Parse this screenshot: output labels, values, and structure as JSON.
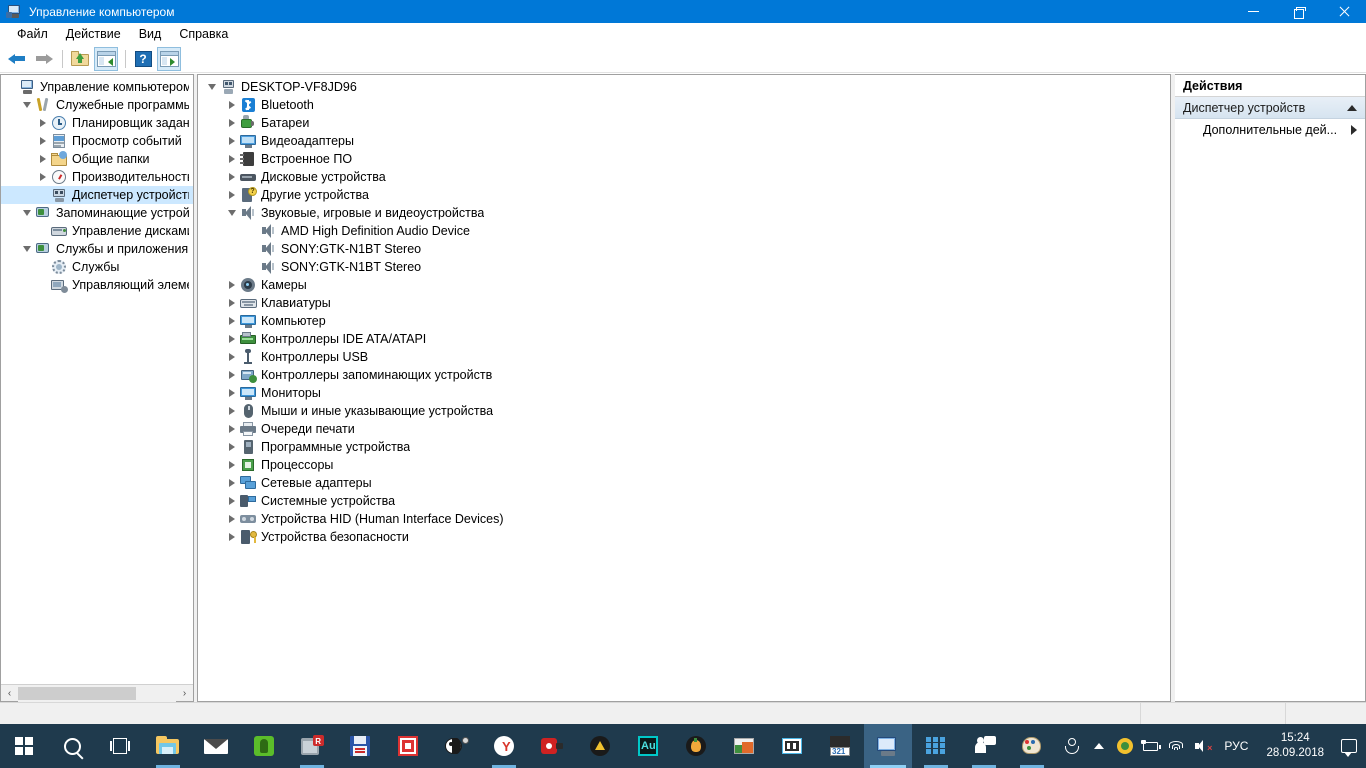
{
  "window": {
    "title": "Управление компьютером",
    "icon": "computer-management-icon",
    "controls": {
      "minimize": "minimize",
      "restore": "restore",
      "close": "close"
    }
  },
  "menubar": {
    "items": [
      {
        "label": "Файл",
        "name": "menu-file"
      },
      {
        "label": "Действие",
        "name": "menu-action"
      },
      {
        "label": "Вид",
        "name": "menu-view"
      },
      {
        "label": "Справка",
        "name": "menu-help"
      }
    ]
  },
  "toolbar": {
    "buttons": [
      {
        "name": "back-button",
        "icon": "arrow-left-icon"
      },
      {
        "name": "forward-button",
        "icon": "arrow-right-icon"
      },
      {
        "name": "up-one-level-button",
        "icon": "folder-up-icon"
      },
      {
        "name": "show-hide-tree-button",
        "icon": "window-tree-icon"
      },
      {
        "name": "help-button",
        "icon": "question-mark-icon"
      },
      {
        "name": "properties-button",
        "icon": "window-play-icon"
      }
    ]
  },
  "sidebar": {
    "items": [
      {
        "label": "Управление компьютером (л",
        "icon": "computer-icon",
        "depth": 0,
        "twist": "none",
        "selected": false
      },
      {
        "label": "Служебные программы",
        "icon": "tools-icon",
        "depth": 1,
        "twist": "open",
        "selected": false
      },
      {
        "label": "Планировщик заданий",
        "icon": "clock-icon",
        "depth": 2,
        "twist": "closed",
        "selected": false
      },
      {
        "label": "Просмотр событий",
        "icon": "event-log-icon",
        "depth": 2,
        "twist": "closed",
        "selected": false
      },
      {
        "label": "Общие папки",
        "icon": "shared-folder-icon",
        "depth": 2,
        "twist": "closed",
        "selected": false
      },
      {
        "label": "Производительность",
        "icon": "performance-icon",
        "depth": 2,
        "twist": "closed",
        "selected": false
      },
      {
        "label": "Диспетчер устройств",
        "icon": "device-manager-icon",
        "depth": 2,
        "twist": "none",
        "selected": true
      },
      {
        "label": "Запоминающие устройст",
        "icon": "storage-icon",
        "depth": 1,
        "twist": "open",
        "selected": false
      },
      {
        "label": "Управление дисками",
        "icon": "disk-management-icon",
        "depth": 2,
        "twist": "none",
        "selected": false
      },
      {
        "label": "Службы и приложения",
        "icon": "services-apps-icon",
        "depth": 1,
        "twist": "open",
        "selected": false
      },
      {
        "label": "Службы",
        "icon": "services-icon",
        "depth": 2,
        "twist": "none",
        "selected": false
      },
      {
        "label": "Управляющий элемен",
        "icon": "wmi-control-icon",
        "depth": 2,
        "twist": "none",
        "selected": false
      }
    ],
    "scrollbar": {
      "left_arrow": "‹",
      "right_arrow": "›"
    }
  },
  "device_tree": {
    "items": [
      {
        "label": "DESKTOP-VF8JD96",
        "icon": "pc-icon",
        "depth": 0,
        "twist": "open"
      },
      {
        "label": "Bluetooth",
        "icon": "bluetooth-icon",
        "depth": 1,
        "twist": "closed"
      },
      {
        "label": "Батареи",
        "icon": "battery-icon",
        "depth": 1,
        "twist": "closed"
      },
      {
        "label": "Видеоадаптеры",
        "icon": "display-adapter-icon",
        "depth": 1,
        "twist": "closed"
      },
      {
        "label": "Встроенное ПО",
        "icon": "firmware-icon",
        "depth": 1,
        "twist": "closed"
      },
      {
        "label": "Дисковые устройства",
        "icon": "disk-drive-icon",
        "depth": 1,
        "twist": "closed"
      },
      {
        "label": "Другие устройства",
        "icon": "other-device-icon",
        "depth": 1,
        "twist": "closed"
      },
      {
        "label": "Звуковые, игровые и видеоустройства",
        "icon": "speaker-icon",
        "depth": 1,
        "twist": "open"
      },
      {
        "label": "AMD High Definition Audio Device",
        "icon": "speaker-icon",
        "depth": 2,
        "twist": "none"
      },
      {
        "label": "SONY:GTK-N1BT Stereo",
        "icon": "speaker-icon",
        "depth": 2,
        "twist": "none"
      },
      {
        "label": "SONY:GTK-N1BT Stereo",
        "icon": "speaker-icon",
        "depth": 2,
        "twist": "none"
      },
      {
        "label": "Камеры",
        "icon": "camera-icon",
        "depth": 1,
        "twist": "closed"
      },
      {
        "label": "Клавиатуры",
        "icon": "keyboard-icon",
        "depth": 1,
        "twist": "closed"
      },
      {
        "label": "Компьютер",
        "icon": "monitor-icon",
        "depth": 1,
        "twist": "closed"
      },
      {
        "label": "Контроллеры IDE ATA/ATAPI",
        "icon": "ide-controller-icon",
        "depth": 1,
        "twist": "closed"
      },
      {
        "label": "Контроллеры USB",
        "icon": "usb-icon",
        "depth": 1,
        "twist": "closed"
      },
      {
        "label": "Контроллеры запоминающих устройств",
        "icon": "storage-controller-icon",
        "depth": 1,
        "twist": "closed"
      },
      {
        "label": "Мониторы",
        "icon": "monitor-icon",
        "depth": 1,
        "twist": "closed"
      },
      {
        "label": "Мыши и иные указывающие устройства",
        "icon": "mouse-icon",
        "depth": 1,
        "twist": "closed"
      },
      {
        "label": "Очереди печати",
        "icon": "printer-icon",
        "depth": 1,
        "twist": "closed"
      },
      {
        "label": "Программные устройства",
        "icon": "software-device-icon",
        "depth": 1,
        "twist": "closed"
      },
      {
        "label": "Процессоры",
        "icon": "cpu-icon",
        "depth": 1,
        "twist": "closed"
      },
      {
        "label": "Сетевые адаптеры",
        "icon": "network-adapter-icon",
        "depth": 1,
        "twist": "closed"
      },
      {
        "label": "Системные устройства",
        "icon": "system-device-icon",
        "depth": 1,
        "twist": "closed"
      },
      {
        "label": "Устройства HID (Human Interface Devices)",
        "icon": "hid-icon",
        "depth": 1,
        "twist": "closed"
      },
      {
        "label": "Устройства безопасности",
        "icon": "security-device-icon",
        "depth": 1,
        "twist": "closed"
      }
    ]
  },
  "actions_pane": {
    "header": "Действия",
    "group_label": "Диспетчер устройств",
    "items": [
      {
        "label": "Дополнительные дей...",
        "name": "more-actions-item"
      }
    ]
  },
  "taskbar": {
    "start": {
      "name": "start-button",
      "icon": "windows-logo-icon"
    },
    "search": {
      "name": "search-button",
      "icon": "search-icon"
    },
    "taskview": {
      "name": "task-view-button",
      "icon": "task-view-icon"
    },
    "apps": [
      {
        "name": "file-explorer",
        "icon": "folder-icon",
        "state": "running"
      },
      {
        "name": "mail",
        "icon": "envelope-icon",
        "state": "idle"
      },
      {
        "name": "evernote",
        "icon": "evernote-icon",
        "state": "idle"
      },
      {
        "name": "rstudio",
        "icon": "rstudio-icon",
        "state": "running"
      },
      {
        "name": "save-app",
        "icon": "floppy-disk-icon",
        "state": "idle"
      },
      {
        "name": "red-app",
        "icon": "red-square-icon",
        "state": "idle"
      },
      {
        "name": "bee-app",
        "icon": "bee-icon",
        "state": "idle"
      },
      {
        "name": "yandex-browser",
        "icon": "yandex-icon",
        "state": "running"
      },
      {
        "name": "camtasia",
        "icon": "camtasia-icon",
        "state": "idle"
      },
      {
        "name": "aimp",
        "icon": "aimp-icon",
        "state": "idle"
      },
      {
        "name": "audition",
        "icon": "audition-icon",
        "state": "idle"
      },
      {
        "name": "fl-studio",
        "icon": "fl-studio-icon",
        "state": "idle"
      },
      {
        "name": "photo-viewer",
        "icon": "photo-icon",
        "state": "idle"
      },
      {
        "name": "video-editor",
        "icon": "film-icon",
        "state": "idle"
      },
      {
        "name": "mpc-player",
        "icon": "mpc-321-icon",
        "state": "idle"
      },
      {
        "name": "computer-management",
        "icon": "computer-management-icon",
        "state": "active"
      },
      {
        "name": "tiles-app",
        "icon": "tiles-icon",
        "state": "running"
      },
      {
        "name": "people-app",
        "icon": "people-chat-icon",
        "state": "running"
      },
      {
        "name": "paint-app",
        "icon": "paint-palette-icon",
        "state": "running"
      }
    ],
    "tray": {
      "people": {
        "name": "people-tray-icon",
        "icon": "person-icon"
      },
      "expand": {
        "name": "show-hidden-icons",
        "icon": "chevron-up-icon"
      },
      "icons": [
        {
          "name": "updater-tray-icon",
          "icon": "green-circle-icon"
        },
        {
          "name": "battery-tray-icon",
          "icon": "battery-icon"
        },
        {
          "name": "network-tray-icon",
          "icon": "wifi-icon"
        },
        {
          "name": "volume-tray-icon",
          "icon": "speaker-muted-icon"
        }
      ],
      "language": "РУС",
      "time": "15:24",
      "date": "28.09.2018",
      "action_center": {
        "name": "action-center-button",
        "icon": "notification-icon"
      }
    }
  },
  "colors": {
    "titlebar": "#0078d7",
    "selection": "#cce8ff",
    "taskbar": "#1f3a4d",
    "accent": "#0078d7"
  }
}
